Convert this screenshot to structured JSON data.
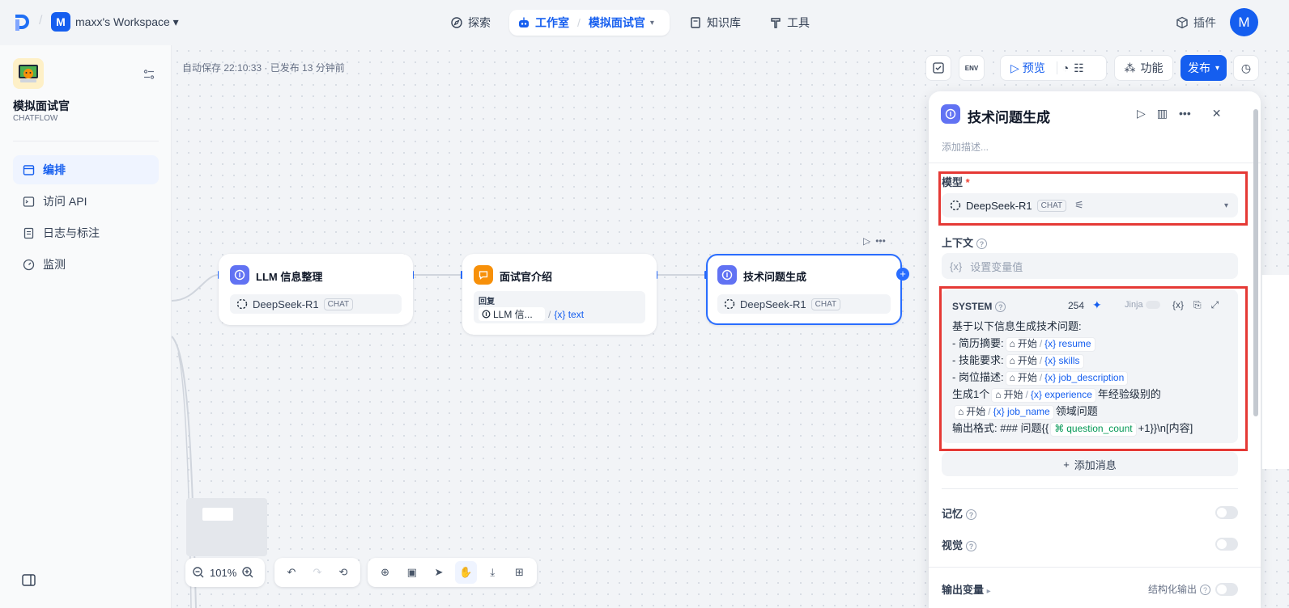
{
  "header": {
    "workspace_initial": "M",
    "workspace_name": "maxx's Workspace",
    "nav": {
      "explore": "探索",
      "studio": "工作室",
      "current_app": "模拟面试官",
      "knowledge": "知识库",
      "tools": "工具"
    },
    "plugins": "插件",
    "user_initial": "M"
  },
  "sidebar": {
    "app_name": "模拟面试官",
    "app_type": "CHATFLOW",
    "items": [
      {
        "label": "编排"
      },
      {
        "label": "访问 API"
      },
      {
        "label": "日志与标注"
      },
      {
        "label": "监测"
      }
    ]
  },
  "canvas": {
    "autosave": "自动保存 22:10:33 · 已发布 13 分钟前",
    "toolbar": {
      "preview": "预览",
      "features": "功能",
      "publish": "发布"
    },
    "nodes": [
      {
        "title": "LLM 信息整理",
        "model": "DeepSeek-R1",
        "chip": "CHAT"
      },
      {
        "title": "面试官介绍",
        "reply_label": "回复",
        "var_node": "LLM 信...",
        "var_name": "text"
      },
      {
        "title": "技术问题生成",
        "model": "DeepSeek-R1",
        "chip": "CHAT"
      }
    ],
    "zoom": "101%"
  },
  "panel": {
    "title": "技术问题生成",
    "description_placeholder": "添加描述...",
    "model_label": "模型",
    "required_mark": "*",
    "model_name": "DeepSeek-R1",
    "model_chip": "CHAT",
    "context_label": "上下文",
    "context_placeholder": "设置变量值",
    "system_label": "SYSTEM",
    "token_count": "254",
    "jinja": "Jinja",
    "prompt": {
      "line1": "基于以下信息生成技术问题:",
      "line2_prefix": "- 简历摘要:",
      "line3_prefix": "- 技能要求:",
      "line4_prefix": "- 岗位描述:",
      "line5_prefix": "生成1个",
      "line5_suffix": "年经验级别的",
      "line6_suffix": "领域问题",
      "line7_prefix": "输出格式: ### 问题{{",
      "line7_suffix": "+1}}\\n[内容]",
      "start_node": "开始",
      "var_resume": "resume",
      "var_skills": "skills",
      "var_job_description": "job_description",
      "var_experience": "experience",
      "var_job_name": "job_name",
      "var_question_count": "question_count"
    },
    "add_message": "添加消息",
    "memory_label": "记忆",
    "vision_label": "视觉",
    "output_vars_label": "输出变量",
    "structured_output_label": "结构化输出"
  }
}
